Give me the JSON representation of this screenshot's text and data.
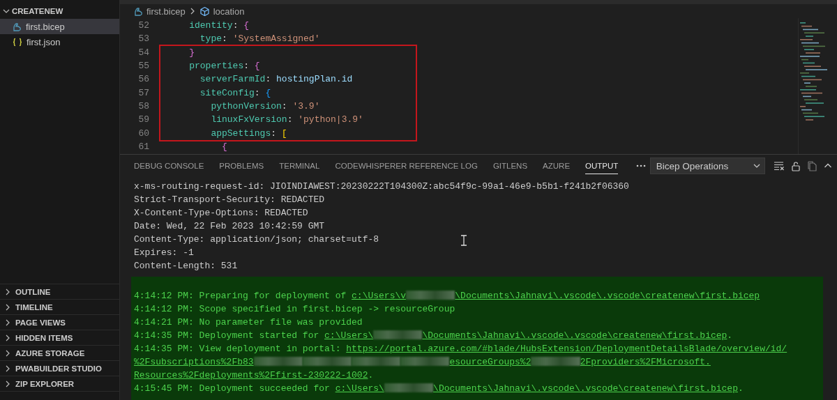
{
  "sidebar": {
    "explorer": {
      "title": "CREATENEW",
      "expanded": true,
      "files": [
        {
          "name": "first.bicep",
          "kind": "bicep",
          "selected": true
        },
        {
          "name": "first.json",
          "kind": "json",
          "selected": false
        }
      ]
    },
    "sections": [
      {
        "title": "OUTLINE",
        "expanded": false
      },
      {
        "title": "TIMELINE",
        "expanded": false
      },
      {
        "title": "PAGE VIEWS",
        "expanded": false
      },
      {
        "title": "HIDDEN ITEMS",
        "expanded": false
      },
      {
        "title": "AZURE STORAGE",
        "expanded": false
      },
      {
        "title": "PWABUILDER STUDIO",
        "expanded": false
      },
      {
        "title": "ZIP EXPLORER",
        "expanded": false
      }
    ]
  },
  "editor": {
    "breadcrumb": [
      {
        "label": "first.bicep",
        "kind": "bicep"
      },
      {
        "label": "location",
        "kind": "symbol"
      }
    ],
    "lines": [
      {
        "number": "52",
        "highlighted": false,
        "tokens": [
          {
            "kind": "key",
            "text": "    identity"
          },
          {
            "kind": "plain",
            "text": ": "
          },
          {
            "kind": "brace1",
            "text": "{"
          }
        ]
      },
      {
        "number": "53",
        "highlighted": false,
        "tokens": [
          {
            "kind": "key",
            "text": "      type"
          },
          {
            "kind": "plain",
            "text": ": "
          },
          {
            "kind": "string",
            "text": "'SystemAssigned'"
          }
        ]
      },
      {
        "number": "54",
        "highlighted": true,
        "tokens": [
          {
            "kind": "brace1",
            "text": "    }"
          }
        ]
      },
      {
        "number": "55",
        "highlighted": true,
        "tokens": [
          {
            "kind": "key",
            "text": "    properties"
          },
          {
            "kind": "plain",
            "text": ": "
          },
          {
            "kind": "brace1",
            "text": "{"
          }
        ]
      },
      {
        "number": "56",
        "highlighted": true,
        "tokens": [
          {
            "kind": "key",
            "text": "      serverFarmId"
          },
          {
            "kind": "plain",
            "text": ": "
          },
          {
            "kind": "ref",
            "text": "hostingPlan.id"
          }
        ]
      },
      {
        "number": "57",
        "highlighted": true,
        "tokens": [
          {
            "kind": "key",
            "text": "      siteConfig"
          },
          {
            "kind": "plain",
            "text": ": "
          },
          {
            "kind": "brace2",
            "text": "{"
          }
        ]
      },
      {
        "number": "58",
        "highlighted": true,
        "tokens": [
          {
            "kind": "key",
            "text": "        pythonVersion"
          },
          {
            "kind": "plain",
            "text": ": "
          },
          {
            "kind": "string",
            "text": "'3.9'"
          }
        ]
      },
      {
        "number": "59",
        "highlighted": true,
        "tokens": [
          {
            "kind": "key",
            "text": "        linuxFxVersion"
          },
          {
            "kind": "plain",
            "text": ": "
          },
          {
            "kind": "string",
            "text": "'python|3.9'"
          }
        ]
      },
      {
        "number": "60",
        "highlighted": true,
        "tokens": [
          {
            "kind": "key",
            "text": "        appSettings"
          },
          {
            "kind": "plain",
            "text": ": "
          },
          {
            "kind": "brace3",
            "text": "["
          }
        ]
      },
      {
        "number": "61",
        "highlighted": false,
        "tokens": [
          {
            "kind": "brace1",
            "text": "          {"
          }
        ]
      }
    ]
  },
  "panel": {
    "tabs": [
      {
        "label": "DEBUG CONSOLE",
        "selected": false
      },
      {
        "label": "PROBLEMS",
        "selected": false
      },
      {
        "label": "TERMINAL",
        "selected": false
      },
      {
        "label": "CODEWHISPERER REFERENCE LOG",
        "selected": false
      },
      {
        "label": "GITLENS",
        "selected": false
      },
      {
        "label": "AZURE",
        "selected": false
      },
      {
        "label": "OUTPUT",
        "selected": true
      }
    ],
    "channel": "Bicep Operations",
    "output": [
      {
        "kind": "plain",
        "segments": [
          {
            "kind": "text",
            "text": "x-ms-routing-request-id: JIOINDIAWEST:20230222T104300Z:abc54f9c-99a1-46e9-b5b1-f241b2f06360"
          }
        ]
      },
      {
        "kind": "plain",
        "segments": [
          {
            "kind": "text",
            "text": "Strict-Transport-Security: REDACTED"
          }
        ]
      },
      {
        "kind": "plain",
        "segments": [
          {
            "kind": "text",
            "text": "X-Content-Type-Options: REDACTED"
          }
        ]
      },
      {
        "kind": "plain",
        "segments": [
          {
            "kind": "text",
            "text": "Date: Wed, 22 Feb 2023 10:42:59 GMT"
          }
        ]
      },
      {
        "kind": "plain",
        "segments": [
          {
            "kind": "text",
            "text": "Content-Type: application/json; charset=utf-8"
          }
        ]
      },
      {
        "kind": "plain",
        "segments": [
          {
            "kind": "text",
            "text": "Expires: -1"
          }
        ]
      },
      {
        "kind": "plain",
        "segments": [
          {
            "kind": "text",
            "text": "Content-Length: 531"
          }
        ]
      },
      {
        "kind": "log",
        "segments": [
          {
            "kind": "text",
            "text": "4:14:12 PM: Preparing for deployment of "
          },
          {
            "kind": "link",
            "text": "c:\\Users\\v"
          },
          {
            "kind": "redacted"
          },
          {
            "kind": "link",
            "text": "\\Documents\\Jahnavi\\.vscode\\.vscode\\createnew\\first.bicep"
          }
        ]
      },
      {
        "kind": "log",
        "segments": [
          {
            "kind": "text",
            "text": "4:14:12 PM: Scope specified in first.bicep -> resourceGroup"
          }
        ]
      },
      {
        "kind": "log",
        "segments": [
          {
            "kind": "text",
            "text": "4:14:21 PM: No parameter file was provided"
          }
        ]
      },
      {
        "kind": "log",
        "segments": [
          {
            "kind": "text",
            "text": "4:14:35 PM: Deployment started for "
          },
          {
            "kind": "link",
            "text": "c:\\Users\\"
          },
          {
            "kind": "redacted"
          },
          {
            "kind": "link",
            "text": "\\Documents\\Jahnavi\\.vscode\\.vscode\\createnew\\first.bicep"
          },
          {
            "kind": "text",
            "text": "."
          }
        ]
      },
      {
        "kind": "log",
        "segments": [
          {
            "kind": "text",
            "text": "4:14:35 PM: View deployment in portal: "
          },
          {
            "kind": "link",
            "text": "https://portal.azure.com/#blade/HubsExtension/DeploymentDetailsBlade/overview/id/"
          }
        ]
      },
      {
        "kind": "log",
        "segments": [
          {
            "kind": "link",
            "text": "%2Fsubscriptions%2Fb83"
          },
          {
            "kind": "redacted"
          },
          {
            "kind": "redacted"
          },
          {
            "kind": "redacted"
          },
          {
            "kind": "redacted"
          },
          {
            "kind": "link",
            "text": "esourceGroups%2"
          },
          {
            "kind": "redacted"
          },
          {
            "kind": "link",
            "text": "2Fproviders%2FMicrosoft."
          }
        ]
      },
      {
        "kind": "log",
        "segments": [
          {
            "kind": "link",
            "text": "Resources%2Fdeployments%2Ffirst-230222-1002"
          },
          {
            "kind": "text",
            "text": "."
          }
        ]
      },
      {
        "kind": "log",
        "segments": [
          {
            "kind": "text",
            "text": "4:15:45 PM: Deployment succeeded for "
          },
          {
            "kind": "link",
            "text": "c:\\Users\\"
          },
          {
            "kind": "redacted"
          },
          {
            "kind": "link",
            "text": "\\Documents\\Jahnavi\\.vscode\\.vscode\\createnew\\first.bicep"
          },
          {
            "kind": "text",
            "text": "."
          }
        ]
      }
    ]
  }
}
